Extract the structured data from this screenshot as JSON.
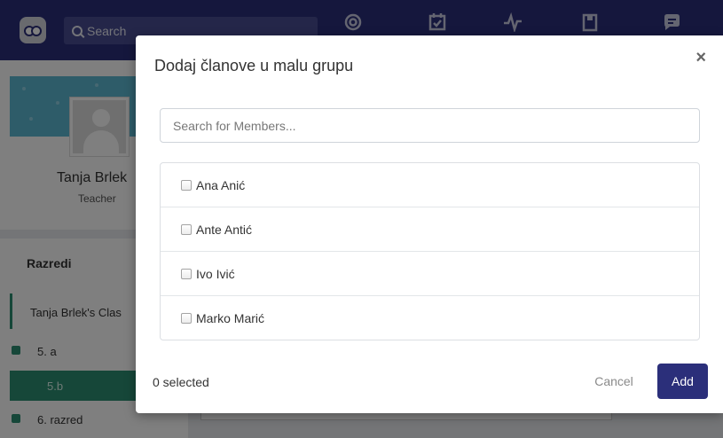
{
  "header": {
    "search_label": "Search",
    "nav_icons": [
      "target-icon",
      "calendar-check-icon",
      "activity-pulse-icon",
      "bookmark-icon",
      "chat-bubble-icon"
    ]
  },
  "sidebar": {
    "teacher_name": "Tanja Brlek",
    "teacher_role": "Teacher",
    "section_title": "Razredi",
    "class_name": "Tanja Brlek's Clas",
    "groups": [
      {
        "label": "5. a",
        "active": false
      },
      {
        "label": "5.b",
        "active": true
      },
      {
        "label": "6. razred",
        "active": false
      }
    ]
  },
  "modal": {
    "title": "Dodaj članove u malu grupu",
    "close_label": "×",
    "search_placeholder": "Search for Members...",
    "members": [
      {
        "name": "Ana Anić",
        "checked": false
      },
      {
        "name": "Ante Antić",
        "checked": false
      },
      {
        "name": "Ivo Ivić",
        "checked": false
      },
      {
        "name": "Marko Marić",
        "checked": false
      }
    ],
    "selected_count": "0 selected",
    "cancel_label": "Cancel",
    "add_label": "Add"
  },
  "colors": {
    "primary": "#2b2f7a",
    "accent_green": "#2d8f73",
    "cover_blue": "#5cb8d3"
  }
}
